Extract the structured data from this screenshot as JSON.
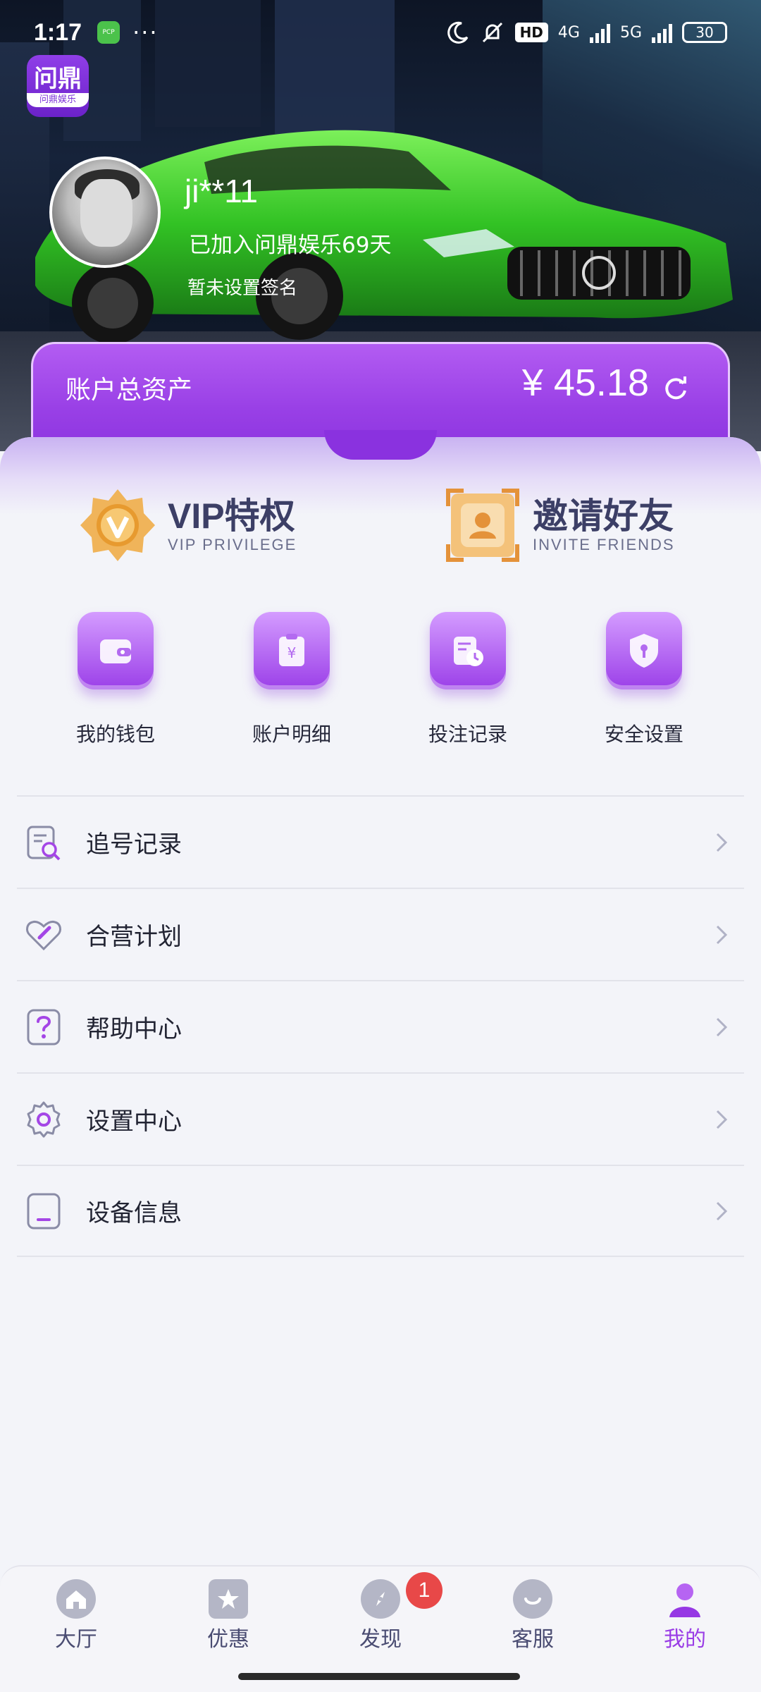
{
  "status_bar": {
    "time": "1:17",
    "app_icon_text": "PCP",
    "more": "···",
    "hd_label": "HD",
    "network_1": "4G",
    "network_2": "5G",
    "battery": "30"
  },
  "app": {
    "logo_title": "问鼎",
    "logo_subtitle": "问鼎娱乐"
  },
  "profile": {
    "username": "ji**11",
    "joined_text": "已加入问鼎娱乐69天",
    "signature": "暂未设置签名"
  },
  "assets": {
    "label": "账户总资产",
    "amount": "¥ 45.18"
  },
  "promos": [
    {
      "title": "VIP特权",
      "subtitle": "VIP PRIVILEGE",
      "icon": "vip-badge-icon"
    },
    {
      "title": "邀请好友",
      "subtitle": "INVITE FRIENDS",
      "icon": "invite-icon"
    }
  ],
  "quick_actions": [
    {
      "label": "我的钱包",
      "icon": "wallet-icon"
    },
    {
      "label": "账户明细",
      "icon": "account-detail-icon"
    },
    {
      "label": "投注记录",
      "icon": "bet-record-icon"
    },
    {
      "label": "安全设置",
      "icon": "security-shield-icon"
    }
  ],
  "menu": [
    {
      "label": "追号记录",
      "icon": "search-record-icon"
    },
    {
      "label": "合营计划",
      "icon": "partnership-icon"
    },
    {
      "label": "帮助中心",
      "icon": "help-icon"
    },
    {
      "label": "设置中心",
      "icon": "gear-icon"
    },
    {
      "label": "设备信息",
      "icon": "device-icon"
    }
  ],
  "tabs": [
    {
      "label": "大厅",
      "icon": "home-icon"
    },
    {
      "label": "优惠",
      "icon": "star-tag-icon"
    },
    {
      "label": "发现",
      "icon": "compass-icon"
    },
    {
      "label": "客服",
      "icon": "service-icon"
    },
    {
      "label": "我的",
      "icon": "profile-icon",
      "active": true
    }
  ],
  "discover_badge": "1",
  "colors": {
    "accent": "#9a3de6",
    "card_purple": "#8a32df",
    "text_dark": "#222433",
    "badge_red": "#e84848"
  }
}
